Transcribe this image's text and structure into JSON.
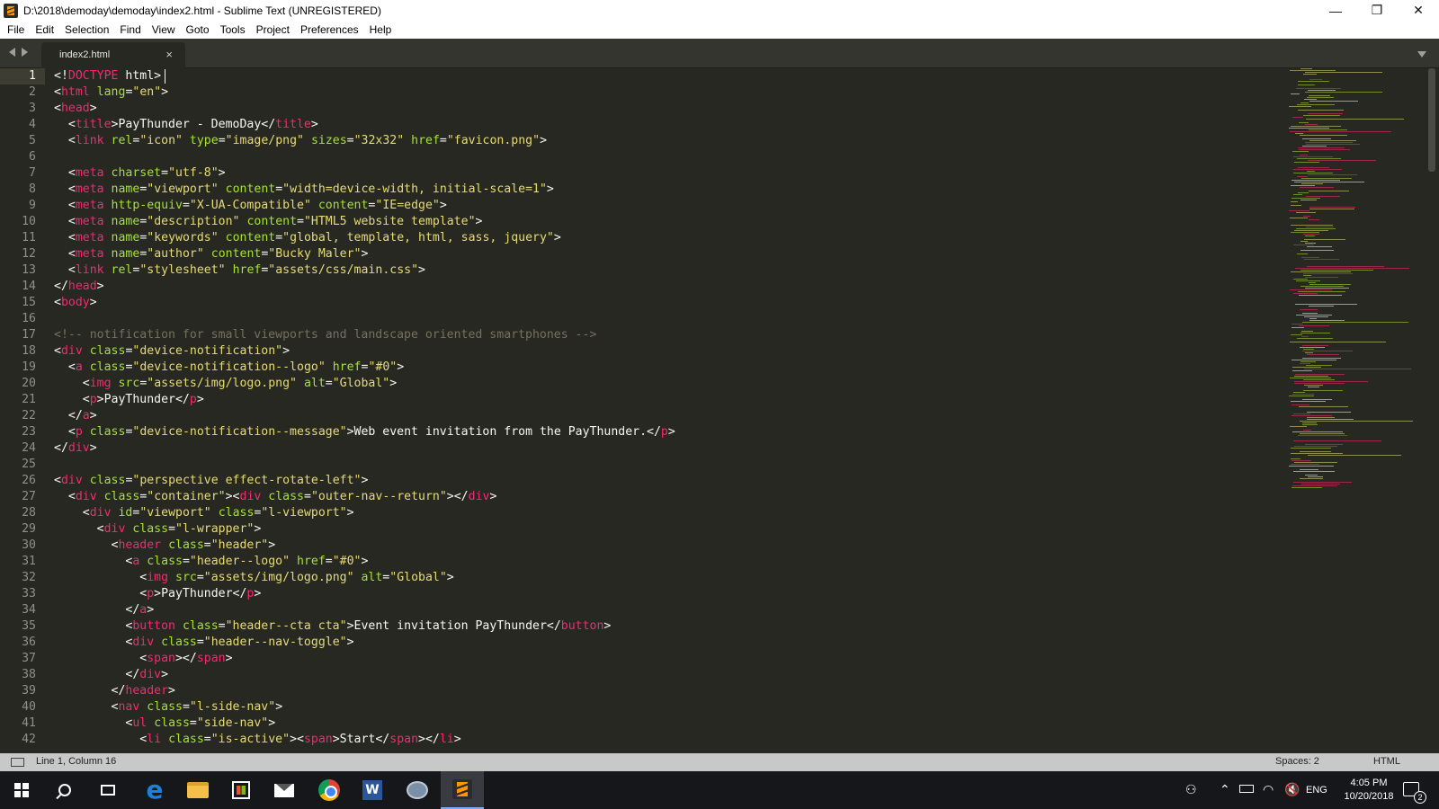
{
  "window": {
    "title": "D:\\2018\\demoday\\demoday\\index2.html - Sublime Text (UNREGISTERED)",
    "minimize_glyph": "—",
    "maximize_glyph": "❐",
    "close_glyph": "✕"
  },
  "menu": [
    "File",
    "Edit",
    "Selection",
    "Find",
    "View",
    "Goto",
    "Tools",
    "Project",
    "Preferences",
    "Help"
  ],
  "tabs": [
    {
      "label": "index2.html",
      "close_glyph": "×",
      "active": true
    }
  ],
  "editor": {
    "current_line": 1,
    "lines": [
      [
        [
          "ca",
          "<!"
        ],
        [
          "tg",
          "DOCTYPE"
        ],
        [
          "ca",
          " html>"
        ]
      ],
      [
        [
          "ca",
          "<"
        ],
        [
          "tg",
          "html"
        ],
        [
          "ca",
          " "
        ],
        [
          "at",
          "lang"
        ],
        [
          "ca",
          "="
        ],
        [
          "st",
          "\"en\""
        ],
        [
          "ca",
          ">"
        ]
      ],
      [
        [
          "ca",
          "<"
        ],
        [
          "tg",
          "head"
        ],
        [
          "ca",
          ">"
        ]
      ],
      [
        [
          "ca",
          "  <"
        ],
        [
          "tg",
          "title"
        ],
        [
          "ca",
          ">PayThunder - DemoDay</"
        ],
        [
          "tg",
          "title"
        ],
        [
          "ca",
          ">"
        ]
      ],
      [
        [
          "ca",
          "  <"
        ],
        [
          "tg",
          "link"
        ],
        [
          "ca",
          " "
        ],
        [
          "at",
          "rel"
        ],
        [
          "ca",
          "="
        ],
        [
          "st",
          "\"icon\""
        ],
        [
          "ca",
          " "
        ],
        [
          "at",
          "type"
        ],
        [
          "ca",
          "="
        ],
        [
          "st",
          "\"image/png\""
        ],
        [
          "ca",
          " "
        ],
        [
          "at",
          "sizes"
        ],
        [
          "ca",
          "="
        ],
        [
          "st",
          "\"32x32\""
        ],
        [
          "ca",
          " "
        ],
        [
          "at",
          "href"
        ],
        [
          "ca",
          "="
        ],
        [
          "st",
          "\"favicon.png\""
        ],
        [
          "ca",
          ">"
        ]
      ],
      [],
      [
        [
          "ca",
          "  <"
        ],
        [
          "tg",
          "meta"
        ],
        [
          "ca",
          " "
        ],
        [
          "at",
          "charset"
        ],
        [
          "ca",
          "="
        ],
        [
          "st",
          "\"utf-8\""
        ],
        [
          "ca",
          ">"
        ]
      ],
      [
        [
          "ca",
          "  <"
        ],
        [
          "tg",
          "meta"
        ],
        [
          "ca",
          " "
        ],
        [
          "at",
          "name"
        ],
        [
          "ca",
          "="
        ],
        [
          "st",
          "\"viewport\""
        ],
        [
          "ca",
          " "
        ],
        [
          "at",
          "content"
        ],
        [
          "ca",
          "="
        ],
        [
          "st",
          "\"width=device-width, initial-scale=1\""
        ],
        [
          "ca",
          ">"
        ]
      ],
      [
        [
          "ca",
          "  <"
        ],
        [
          "tg",
          "meta"
        ],
        [
          "ca",
          " "
        ],
        [
          "at",
          "http-equiv"
        ],
        [
          "ca",
          "="
        ],
        [
          "st",
          "\"X-UA-Compatible\""
        ],
        [
          "ca",
          " "
        ],
        [
          "at",
          "content"
        ],
        [
          "ca",
          "="
        ],
        [
          "st",
          "\"IE=edge\""
        ],
        [
          "ca",
          ">"
        ]
      ],
      [
        [
          "ca",
          "  <"
        ],
        [
          "tg",
          "meta"
        ],
        [
          "ca",
          " "
        ],
        [
          "at",
          "name"
        ],
        [
          "ca",
          "="
        ],
        [
          "st",
          "\"description\""
        ],
        [
          "ca",
          " "
        ],
        [
          "at",
          "content"
        ],
        [
          "ca",
          "="
        ],
        [
          "st",
          "\"HTML5 website template\""
        ],
        [
          "ca",
          ">"
        ]
      ],
      [
        [
          "ca",
          "  <"
        ],
        [
          "tg",
          "meta"
        ],
        [
          "ca",
          " "
        ],
        [
          "at",
          "name"
        ],
        [
          "ca",
          "="
        ],
        [
          "st",
          "\"keywords\""
        ],
        [
          "ca",
          " "
        ],
        [
          "at",
          "content"
        ],
        [
          "ca",
          "="
        ],
        [
          "st",
          "\"global, template, html, sass, jquery\""
        ],
        [
          "ca",
          ">"
        ]
      ],
      [
        [
          "ca",
          "  <"
        ],
        [
          "tg",
          "meta"
        ],
        [
          "ca",
          " "
        ],
        [
          "at",
          "name"
        ],
        [
          "ca",
          "="
        ],
        [
          "st",
          "\"author\""
        ],
        [
          "ca",
          " "
        ],
        [
          "at",
          "content"
        ],
        [
          "ca",
          "="
        ],
        [
          "st",
          "\"Bucky Maler\""
        ],
        [
          "ca",
          ">"
        ]
      ],
      [
        [
          "ca",
          "  <"
        ],
        [
          "tg",
          "link"
        ],
        [
          "ca",
          " "
        ],
        [
          "at",
          "rel"
        ],
        [
          "ca",
          "="
        ],
        [
          "st",
          "\"stylesheet\""
        ],
        [
          "ca",
          " "
        ],
        [
          "at",
          "href"
        ],
        [
          "ca",
          "="
        ],
        [
          "st",
          "\"assets/css/main.css\""
        ],
        [
          "ca",
          ">"
        ]
      ],
      [
        [
          "ca",
          "</"
        ],
        [
          "tg",
          "head"
        ],
        [
          "ca",
          ">"
        ]
      ],
      [
        [
          "ca",
          "<"
        ],
        [
          "tg",
          "body"
        ],
        [
          "ca",
          ">"
        ]
      ],
      [],
      [
        [
          "cm",
          "<!-- notification for small viewports and landscape oriented smartphones -->"
        ]
      ],
      [
        [
          "ca",
          "<"
        ],
        [
          "tg",
          "div"
        ],
        [
          "ca",
          " "
        ],
        [
          "at",
          "class"
        ],
        [
          "ca",
          "="
        ],
        [
          "st",
          "\"device-notification\""
        ],
        [
          "ca",
          ">"
        ]
      ],
      [
        [
          "ca",
          "  <"
        ],
        [
          "tg",
          "a"
        ],
        [
          "ca",
          " "
        ],
        [
          "at",
          "class"
        ],
        [
          "ca",
          "="
        ],
        [
          "st",
          "\"device-notification--logo\""
        ],
        [
          "ca",
          " "
        ],
        [
          "at",
          "href"
        ],
        [
          "ca",
          "="
        ],
        [
          "st",
          "\"#0\""
        ],
        [
          "ca",
          ">"
        ]
      ],
      [
        [
          "ca",
          "    <"
        ],
        [
          "tg",
          "img"
        ],
        [
          "ca",
          " "
        ],
        [
          "at",
          "src"
        ],
        [
          "ca",
          "="
        ],
        [
          "st",
          "\"assets/img/logo.png\""
        ],
        [
          "ca",
          " "
        ],
        [
          "at",
          "alt"
        ],
        [
          "ca",
          "="
        ],
        [
          "st",
          "\"Global\""
        ],
        [
          "ca",
          ">"
        ]
      ],
      [
        [
          "ca",
          "    <"
        ],
        [
          "tg",
          "p"
        ],
        [
          "ca",
          ">PayThunder</"
        ],
        [
          "tg",
          "p"
        ],
        [
          "ca",
          ">"
        ]
      ],
      [
        [
          "ca",
          "  </"
        ],
        [
          "tg",
          "a"
        ],
        [
          "ca",
          ">"
        ]
      ],
      [
        [
          "ca",
          "  <"
        ],
        [
          "tg",
          "p"
        ],
        [
          "ca",
          " "
        ],
        [
          "at",
          "class"
        ],
        [
          "ca",
          "="
        ],
        [
          "st",
          "\"device-notification--message\""
        ],
        [
          "ca",
          ">Web event invitation from the PayThunder.</"
        ],
        [
          "tg",
          "p"
        ],
        [
          "ca",
          ">"
        ]
      ],
      [
        [
          "ca",
          "</"
        ],
        [
          "tg",
          "div"
        ],
        [
          "ca",
          ">"
        ]
      ],
      [],
      [
        [
          "ca",
          "<"
        ],
        [
          "tg",
          "div"
        ],
        [
          "ca",
          " "
        ],
        [
          "at",
          "class"
        ],
        [
          "ca",
          "="
        ],
        [
          "st",
          "\"perspective effect-rotate-left\""
        ],
        [
          "ca",
          ">"
        ]
      ],
      [
        [
          "ca",
          "  <"
        ],
        [
          "tg",
          "div"
        ],
        [
          "ca",
          " "
        ],
        [
          "at",
          "class"
        ],
        [
          "ca",
          "="
        ],
        [
          "st",
          "\"container\""
        ],
        [
          "ca",
          "><"
        ],
        [
          "tg",
          "div"
        ],
        [
          "ca",
          " "
        ],
        [
          "at",
          "class"
        ],
        [
          "ca",
          "="
        ],
        [
          "st",
          "\"outer-nav--return\""
        ],
        [
          "ca",
          "></"
        ],
        [
          "tg",
          "div"
        ],
        [
          "ca",
          ">"
        ]
      ],
      [
        [
          "ca",
          "    <"
        ],
        [
          "tg",
          "div"
        ],
        [
          "ca",
          " "
        ],
        [
          "at",
          "id"
        ],
        [
          "ca",
          "="
        ],
        [
          "st",
          "\"viewport\""
        ],
        [
          "ca",
          " "
        ],
        [
          "at",
          "class"
        ],
        [
          "ca",
          "="
        ],
        [
          "st",
          "\"l-viewport\""
        ],
        [
          "ca",
          ">"
        ]
      ],
      [
        [
          "ca",
          "      <"
        ],
        [
          "tg",
          "div"
        ],
        [
          "ca",
          " "
        ],
        [
          "at",
          "class"
        ],
        [
          "ca",
          "="
        ],
        [
          "st",
          "\"l-wrapper\""
        ],
        [
          "ca",
          ">"
        ]
      ],
      [
        [
          "ca",
          "        <"
        ],
        [
          "tg",
          "header"
        ],
        [
          "ca",
          " "
        ],
        [
          "at",
          "class"
        ],
        [
          "ca",
          "="
        ],
        [
          "st",
          "\"header\""
        ],
        [
          "ca",
          ">"
        ]
      ],
      [
        [
          "ca",
          "          <"
        ],
        [
          "tg",
          "a"
        ],
        [
          "ca",
          " "
        ],
        [
          "at",
          "class"
        ],
        [
          "ca",
          "="
        ],
        [
          "st",
          "\"header--logo\""
        ],
        [
          "ca",
          " "
        ],
        [
          "at",
          "href"
        ],
        [
          "ca",
          "="
        ],
        [
          "st",
          "\"#0\""
        ],
        [
          "ca",
          ">"
        ]
      ],
      [
        [
          "ca",
          "            <"
        ],
        [
          "tg",
          "img"
        ],
        [
          "ca",
          " "
        ],
        [
          "at",
          "src"
        ],
        [
          "ca",
          "="
        ],
        [
          "st",
          "\"assets/img/logo.png\""
        ],
        [
          "ca",
          " "
        ],
        [
          "at",
          "alt"
        ],
        [
          "ca",
          "="
        ],
        [
          "st",
          "\"Global\""
        ],
        [
          "ca",
          ">"
        ]
      ],
      [
        [
          "ca",
          "            <"
        ],
        [
          "tg",
          "p"
        ],
        [
          "ca",
          ">PayThunder</"
        ],
        [
          "tg",
          "p"
        ],
        [
          "ca",
          ">"
        ]
      ],
      [
        [
          "ca",
          "          </"
        ],
        [
          "tg",
          "a"
        ],
        [
          "ca",
          ">"
        ]
      ],
      [
        [
          "ca",
          "          <"
        ],
        [
          "tg",
          "button"
        ],
        [
          "ca",
          " "
        ],
        [
          "at",
          "class"
        ],
        [
          "ca",
          "="
        ],
        [
          "st",
          "\"header--cta cta\""
        ],
        [
          "ca",
          ">Event invitation PayThunder</"
        ],
        [
          "tg",
          "button"
        ],
        [
          "ca",
          ">"
        ]
      ],
      [
        [
          "ca",
          "          <"
        ],
        [
          "tg",
          "div"
        ],
        [
          "ca",
          " "
        ],
        [
          "at",
          "class"
        ],
        [
          "ca",
          "="
        ],
        [
          "st",
          "\"header--nav-toggle\""
        ],
        [
          "ca",
          ">"
        ]
      ],
      [
        [
          "ca",
          "            <"
        ],
        [
          "tg",
          "span"
        ],
        [
          "ca",
          "></"
        ],
        [
          "tg",
          "span"
        ],
        [
          "ca",
          ">"
        ]
      ],
      [
        [
          "ca",
          "          </"
        ],
        [
          "tg",
          "div"
        ],
        [
          "ca",
          ">"
        ]
      ],
      [
        [
          "ca",
          "        </"
        ],
        [
          "tg",
          "header"
        ],
        [
          "ca",
          ">"
        ]
      ],
      [
        [
          "ca",
          "        <"
        ],
        [
          "tg",
          "nav"
        ],
        [
          "ca",
          " "
        ],
        [
          "at",
          "class"
        ],
        [
          "ca",
          "="
        ],
        [
          "st",
          "\"l-side-nav\""
        ],
        [
          "ca",
          ">"
        ]
      ],
      [
        [
          "ca",
          "          <"
        ],
        [
          "tg",
          "ul"
        ],
        [
          "ca",
          " "
        ],
        [
          "at",
          "class"
        ],
        [
          "ca",
          "="
        ],
        [
          "st",
          "\"side-nav\""
        ],
        [
          "ca",
          ">"
        ]
      ],
      [
        [
          "ca",
          "            <"
        ],
        [
          "tg",
          "li"
        ],
        [
          "ca",
          " "
        ],
        [
          "at",
          "class"
        ],
        [
          "ca",
          "="
        ],
        [
          "st",
          "\"is-active\""
        ],
        [
          "ca",
          "><"
        ],
        [
          "tg",
          "span"
        ],
        [
          "ca",
          ">Start</"
        ],
        [
          "tg",
          "span"
        ],
        [
          "ca",
          "></"
        ],
        [
          "tg",
          "li"
        ],
        [
          "ca",
          ">"
        ]
      ]
    ]
  },
  "statusbar": {
    "position": "Line 1, Column 16",
    "indentation": "Spaces: 2",
    "syntax": "HTML"
  },
  "taskbar": {
    "apps": [
      "start",
      "search",
      "task-view",
      "edge",
      "file-explorer",
      "store",
      "mail",
      "chrome",
      "word",
      "feedback-hub",
      "sublime-text"
    ],
    "word_letter": "W",
    "tray": {
      "people_glyph": "⚇",
      "up_glyph": "⌃",
      "wifi_glyph": "◠",
      "volume_glyph": "🔇",
      "language": "ENG",
      "time": "4:05 PM",
      "date": "10/20/2018",
      "notification_count": "2"
    }
  },
  "colors": {
    "editor_bg": "#272822",
    "tag": "#f92672",
    "attribute": "#a6e22e",
    "string": "#e6db74",
    "comment": "#75715e",
    "text": "#f8f8f2"
  }
}
